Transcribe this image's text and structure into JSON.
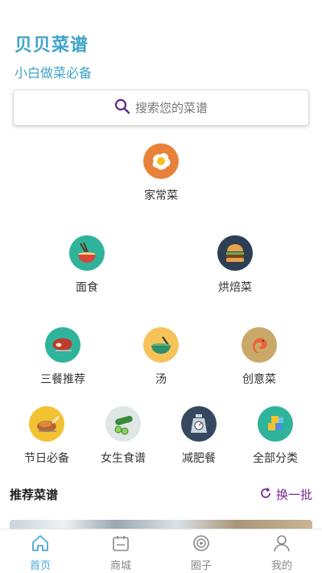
{
  "header": {
    "title": "贝贝菜谱",
    "subtitle": "小白做菜必备"
  },
  "search": {
    "placeholder": "搜索您的菜谱"
  },
  "categories": [
    {
      "label": "家常菜",
      "icon": "fried-egg-icon"
    },
    {
      "label": "面食",
      "icon": "noodle-bowl-icon"
    },
    {
      "label": "烘焙菜",
      "icon": "burger-icon"
    },
    {
      "label": "三餐推荐",
      "icon": "steak-icon"
    },
    {
      "label": "汤",
      "icon": "soup-bowl-icon"
    },
    {
      "label": "创意菜",
      "icon": "shrimp-icon"
    },
    {
      "label": "节日必备",
      "icon": "roast-chicken-icon"
    },
    {
      "label": "女生食谱",
      "icon": "cucumber-icon"
    },
    {
      "label": "减肥餐",
      "icon": "scale-icon"
    },
    {
      "label": "全部分类",
      "icon": "blocks-icon"
    }
  ],
  "recommend": {
    "title": "推荐菜谱",
    "refresh_label": "换一批"
  },
  "tabbar": [
    {
      "label": "首页",
      "icon": "home-icon",
      "active": true
    },
    {
      "label": "商城",
      "icon": "calendar-icon",
      "active": false
    },
    {
      "label": "圈子",
      "icon": "circle-target-icon",
      "active": false
    },
    {
      "label": "我的",
      "icon": "user-icon",
      "active": false
    }
  ],
  "colors": {
    "accent": "#3fa3c8",
    "refresh": "#7a2a90",
    "tab_active": "#4aa8d8"
  }
}
